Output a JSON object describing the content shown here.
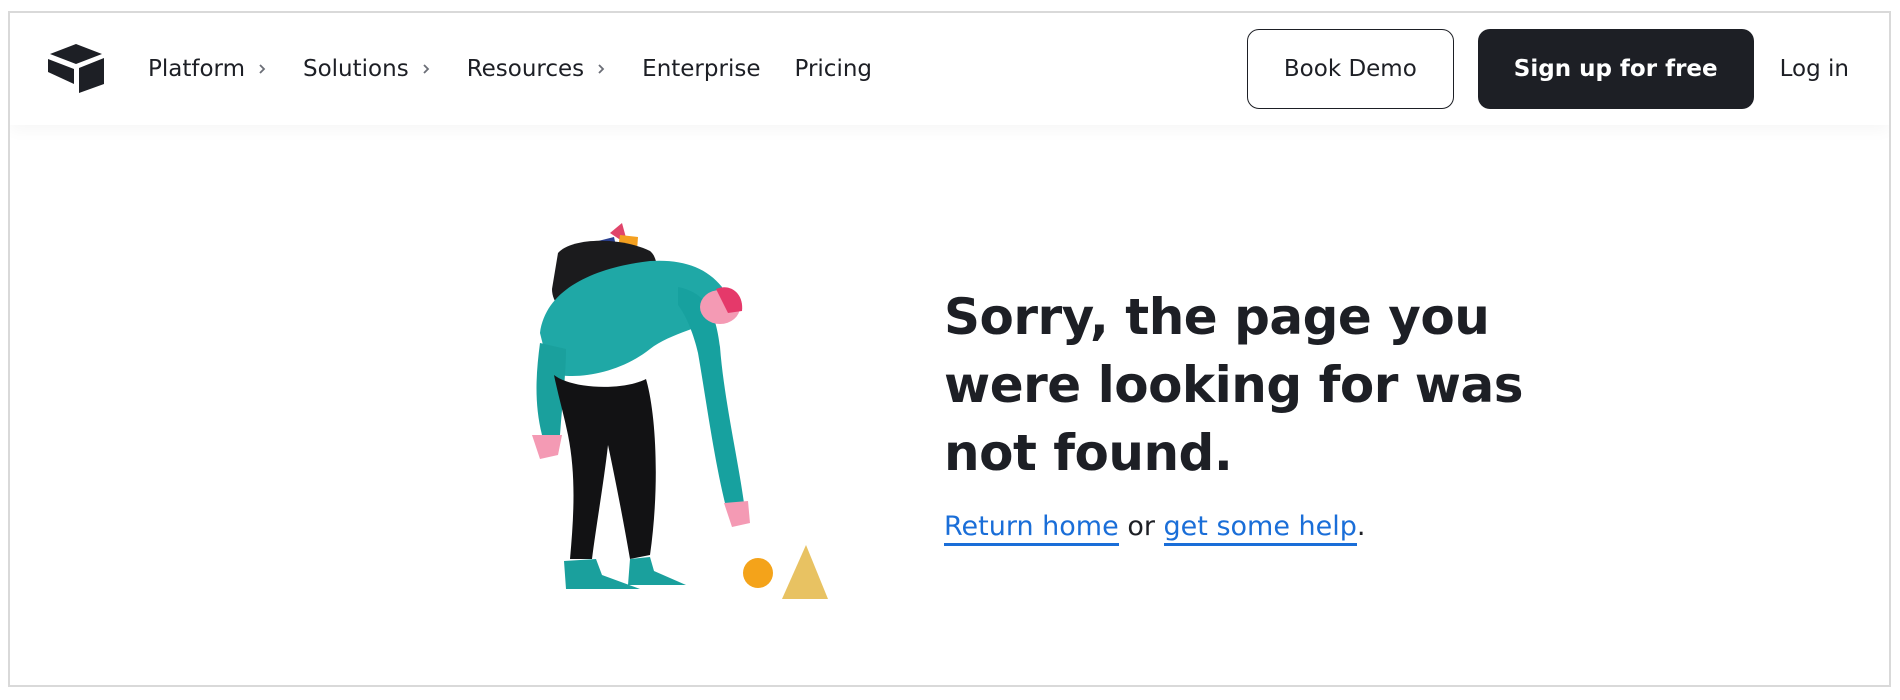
{
  "nav": {
    "logo_icon": "airtable-logo-icon",
    "items": [
      {
        "label": "Platform",
        "has_submenu": true
      },
      {
        "label": "Solutions",
        "has_submenu": true
      },
      {
        "label": "Resources",
        "has_submenu": true
      },
      {
        "label": "Enterprise",
        "has_submenu": false
      },
      {
        "label": "Pricing",
        "has_submenu": false
      }
    ],
    "book_demo_label": "Book Demo",
    "signup_label": "Sign up for free",
    "login_label": "Log in"
  },
  "error": {
    "illustration": "lost-person-illustration",
    "headline_lines": [
      "Sorry, the page you",
      "were looking for was",
      "not found."
    ],
    "return_home_label": "Return home",
    "connector": " or ",
    "help_label": "get some help",
    "trailing": "."
  },
  "colors": {
    "text": "#1d1f25",
    "link": "#1a6ed8",
    "button_dark": "#1d1f25",
    "border": "#d9d9d9"
  }
}
